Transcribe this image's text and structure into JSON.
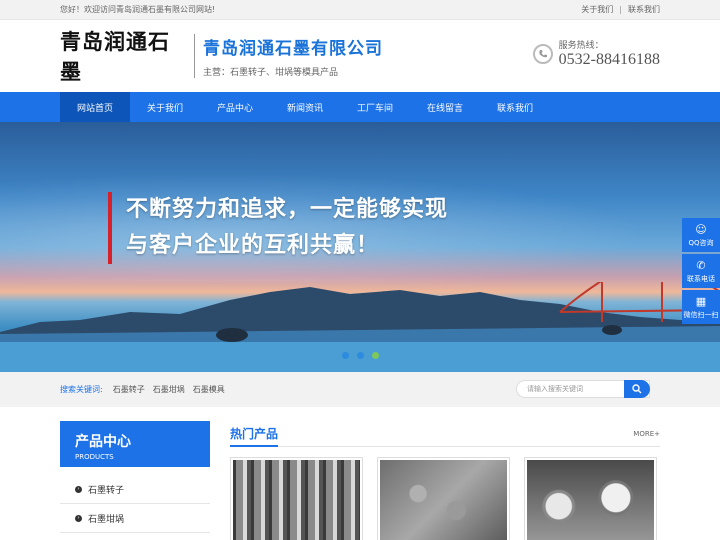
{
  "topbar": {
    "welcome": "您好！欢迎访问青岛润通石墨有限公司网站!",
    "about_link": "关于我们",
    "separator": "|",
    "contact_link": "联系我们"
  },
  "header": {
    "logo_text": "青岛润通石墨",
    "company_name": "青岛润通石墨有限公司",
    "main_business": "主营：石墨转子、坩埚等模具产品",
    "hotline_label": "服务热线：",
    "hotline_number": "0532-88416188"
  },
  "nav": {
    "items": [
      {
        "label": "网站首页"
      },
      {
        "label": "关于我们"
      },
      {
        "label": "产品中心"
      },
      {
        "label": "新闻资讯"
      },
      {
        "label": "工厂车间"
      },
      {
        "label": "在线留言"
      },
      {
        "label": "联系我们"
      }
    ]
  },
  "banner": {
    "line1": "不断努力和追求，一定能够实现",
    "line2": "与客户企业的互利共赢！",
    "accent_color": "#d6202a"
  },
  "float_bar": {
    "qq": "QQ咨询",
    "phone": "联系电话",
    "wechat": "微信扫一扫"
  },
  "search": {
    "label": "搜索关键词:",
    "keywords": [
      "石墨转子",
      "石墨坩埚",
      "石墨模具"
    ],
    "placeholder": "请输入搜索关键词"
  },
  "sidebar": {
    "title": "产品中心",
    "title_en": "PRODUCTS",
    "items": [
      {
        "label": "石墨转子"
      },
      {
        "label": "石墨坩埚"
      }
    ]
  },
  "main": {
    "title": "热门产品",
    "more": "MORE+"
  },
  "colors": {
    "brand": "#1d72e8",
    "nav_active": "#0d55b8"
  }
}
